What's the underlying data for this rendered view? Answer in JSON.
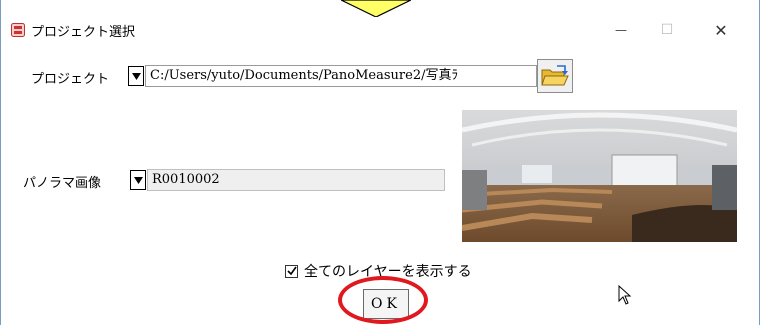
{
  "window": {
    "title": "プロジェクト選択",
    "minimize_glyph": "—",
    "maximize_glyph": "☐",
    "close_glyph": "✕"
  },
  "project": {
    "label": "プロジェクト",
    "path": "C:/Users/yuto/Documents/PanoMeasure2/写真ﾗ",
    "browse_icon": "folder-open-icon"
  },
  "panorama": {
    "label": "パノラマ画像",
    "value": "R0010002"
  },
  "options": {
    "show_all_layers_label": "全てのレイヤーを表示する",
    "show_all_layers_checked": true
  },
  "actions": {
    "ok_label": "OK"
  },
  "colors": {
    "highlight_ring": "#e0191e",
    "arrow_fill": "#ffff66",
    "window_border": "#7a9cc4"
  }
}
